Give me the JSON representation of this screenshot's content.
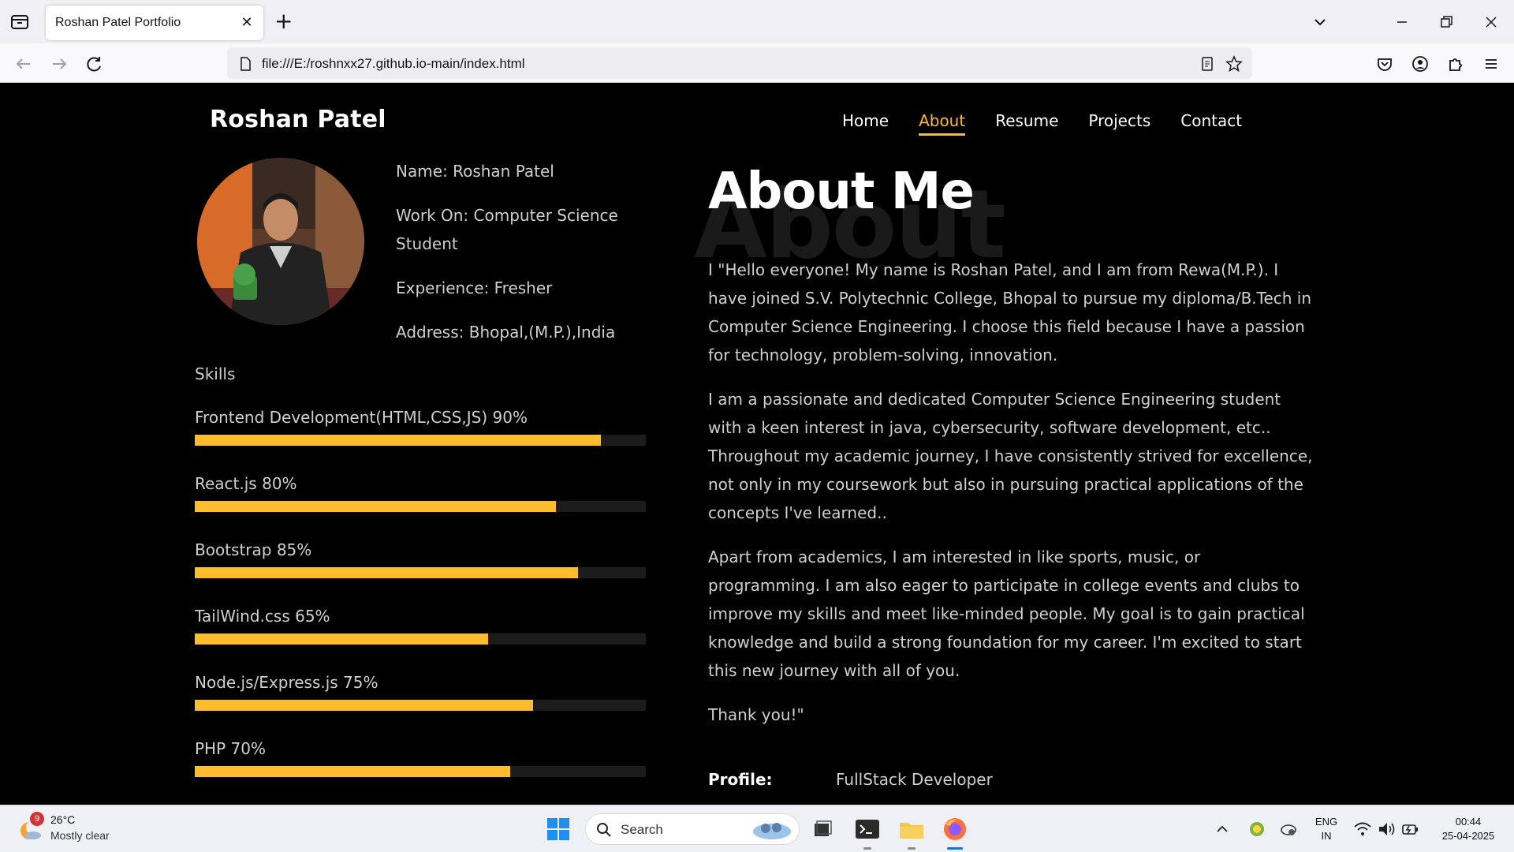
{
  "browser": {
    "tab_title": "Roshan Patel Portfolio",
    "close_tab": "✕",
    "new_tab": "+",
    "url": "file:///E:/roshnxx27.github.io-main/index.html"
  },
  "site": {
    "brand": "Roshan Patel",
    "nav": [
      "Home",
      "About",
      "Resume",
      "Projects",
      "Contact"
    ],
    "active_nav": "About",
    "accent_color": "#ffb82e"
  },
  "info": {
    "name": "Name: Roshan Patel",
    "work": "Work On: Computer Science Student",
    "experience": "Experience: Fresher",
    "address": "Address: Bhopal,(M.P.),India"
  },
  "skills": {
    "title": "Skills",
    "items": [
      {
        "label": "Frontend Development(HTML,CSS,JS) 90%",
        "level": 90
      },
      {
        "label": "React.js 80%",
        "level": 80
      },
      {
        "label": "Bootstrap 85%",
        "level": 85
      },
      {
        "label": "TailWind.css 65%",
        "level": 65
      },
      {
        "label": "Node.js/Express.js 75%",
        "level": 75
      },
      {
        "label": "PHP 70%",
        "level": 70
      }
    ]
  },
  "about": {
    "bg_word": "About",
    "title": "About Me",
    "paragraphs": [
      "I \"Hello everyone! My name is Roshan Patel, and I am from Rewa(M.P.). I have joined S.V. Polytechnic College, Bhopal to pursue my diploma/B.Tech in Computer Science Engineering. I choose this field because I have a passion for technology, problem-solving, innovation.",
      "I am a passionate and dedicated Computer Science Engineering student with a keen interest in java, cybersecurity, software development, etc.. Throughout my academic journey, I have consistently strived for excellence, not only in my coursework but also in pursuing practical applications of the concepts I've learned..",
      "Apart from academics, I am interested in like sports, music, or programming. I am also eager to participate in college events and clubs to improve my skills and meet like-minded people. My goal is to gain practical knowledge and build a strong foundation for my career. I'm excited to start this new journey with all of you.",
      "Thank you!\""
    ],
    "profile_label": "Profile:",
    "profile_value": "FullStack Developer"
  },
  "taskbar": {
    "weather_temp": "26°C",
    "weather_desc": "Mostly clear",
    "weather_badge": "9",
    "search_label": "Search",
    "lang_top": "ENG",
    "lang_bottom": "IN",
    "time": "00:44",
    "date": "25-04-2025"
  }
}
